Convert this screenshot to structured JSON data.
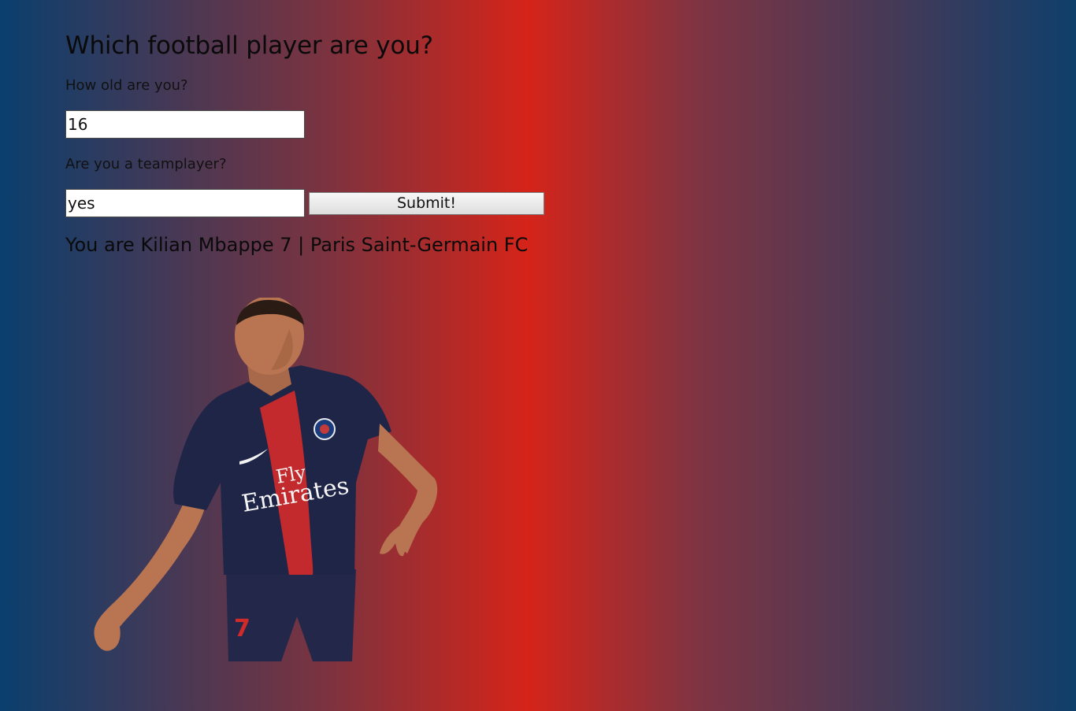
{
  "page": {
    "title": "Which football player are you?"
  },
  "form": {
    "age_question": "How old are you?",
    "age_value": "16",
    "team_question": "Are you a teamplayer?",
    "team_value": "yes",
    "submit_label": "Submit!"
  },
  "result": {
    "text": "You are Kilian Mbappe 7 | Paris Saint-Germain FC"
  },
  "player_image": {
    "shirt_sponsor_line1": "Fly",
    "shirt_sponsor_line2": "Emirates",
    "shirt_number": "7"
  },
  "colors": {
    "gradient_edge": "#0a3f6e",
    "gradient_center": "#d52419",
    "shirt_navy": "#1f2547",
    "shirt_red_stripe": "#d12a2b",
    "skin": "#b97552"
  }
}
